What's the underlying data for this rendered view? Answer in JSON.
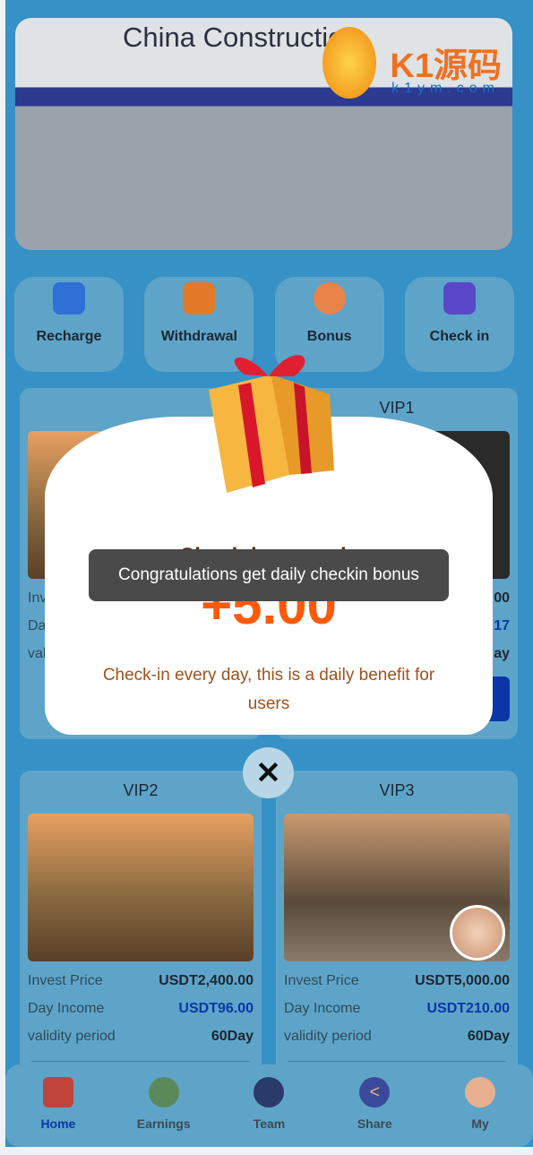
{
  "banner": {
    "sign_text": "China Construction",
    "watermark": "K1源码",
    "watermark_sub": "k1ym.com"
  },
  "actions": [
    {
      "label": "Recharge",
      "icon": "recharge-icon",
      "color": "#2f6fd6"
    },
    {
      "label": "Withdrawal",
      "icon": "withdrawal-icon",
      "color": "#e07a28"
    },
    {
      "label": "Bonus",
      "icon": "bonus-icon",
      "color": "#e8844a"
    },
    {
      "label": "Check in",
      "icon": "checkin-icon",
      "color": "#5a48c8"
    }
  ],
  "products": [
    {
      "title": "",
      "invest_label": "Invest Price",
      "income_label": "Day Income",
      "validity_label": "validity period",
      "invest": "",
      "income": "",
      "validity": ""
    },
    {
      "title": "VIP1",
      "invest_label": "",
      "income_label": "",
      "validity_label": "",
      "invest": "00",
      "income": "17",
      "validity": "ay"
    },
    {
      "title": "VIP2",
      "invest_label": "Invest Price",
      "income_label": "Day Income",
      "validity_label": "validity period",
      "invest": "USDT2,400.00",
      "income": "USDT96.00",
      "validity": "60Day"
    },
    {
      "title": "VIP3",
      "invest_label": "Invest Price",
      "income_label": "Day Income",
      "validity_label": "validity period",
      "invest": "USDT5,000.00",
      "income": "USDT210.00",
      "validity": "60Day"
    }
  ],
  "modal": {
    "title": "Check-in rewards",
    "amount": "+5.00",
    "description": "Check-in every day, this is a daily benefit for users",
    "close_icon": "close-icon"
  },
  "toast": "Congratulations get daily checkin bonus",
  "nav": [
    {
      "label": "Home",
      "icon": "home-icon",
      "active": true
    },
    {
      "label": "Earnings",
      "icon": "earnings-icon"
    },
    {
      "label": "Team",
      "icon": "team-icon"
    },
    {
      "label": "Share",
      "icon": "share-icon"
    },
    {
      "label": "My",
      "icon": "profile-icon"
    }
  ],
  "colors": {
    "background": "#3591c6",
    "card": "#5ea4c9",
    "accent": "#0a36a8",
    "amount": "#fc5a0a"
  }
}
